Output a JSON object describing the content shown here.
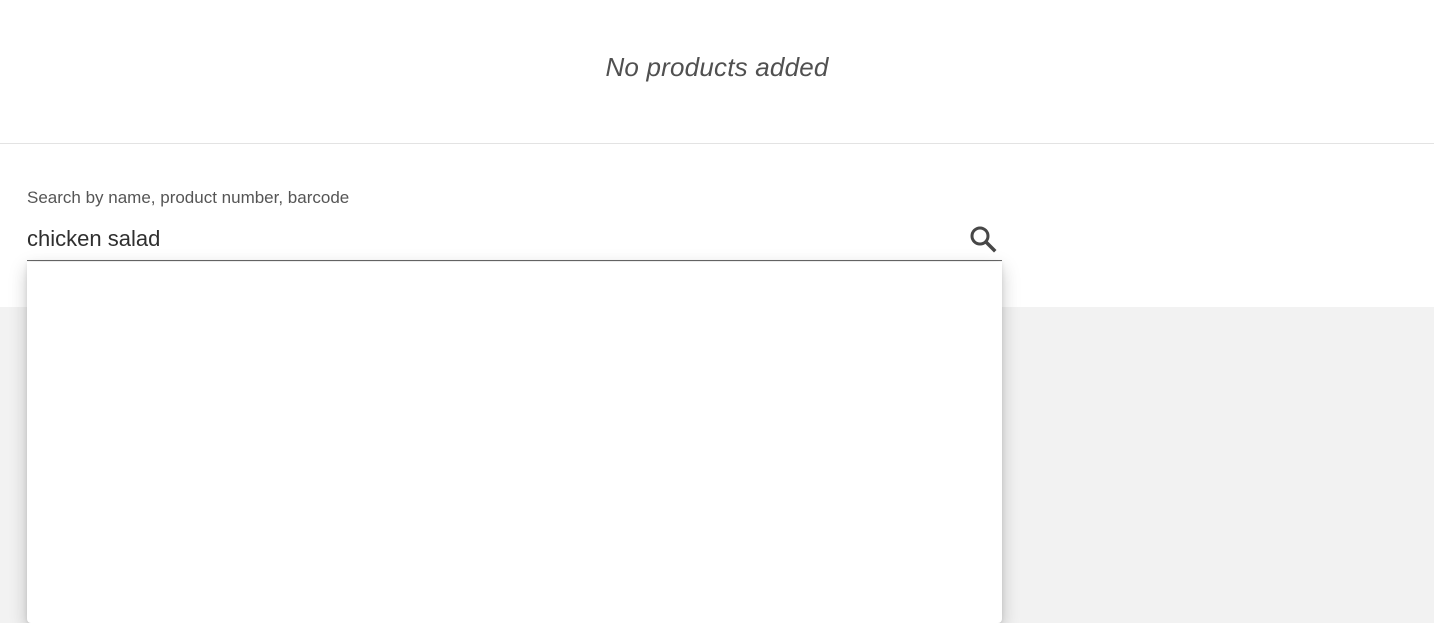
{
  "cart": {
    "empty_message": "No products added"
  },
  "search": {
    "label": "Search by name, product number, barcode",
    "value": "chicken salad",
    "icon": "search-icon"
  },
  "colors": {
    "page_background": "#ffffff",
    "lower_background": "#f2f2f2",
    "text": "#333333",
    "muted_text": "#555555",
    "divider": "#e3e3e3"
  },
  "dropdown": {
    "state": "open",
    "results": []
  }
}
